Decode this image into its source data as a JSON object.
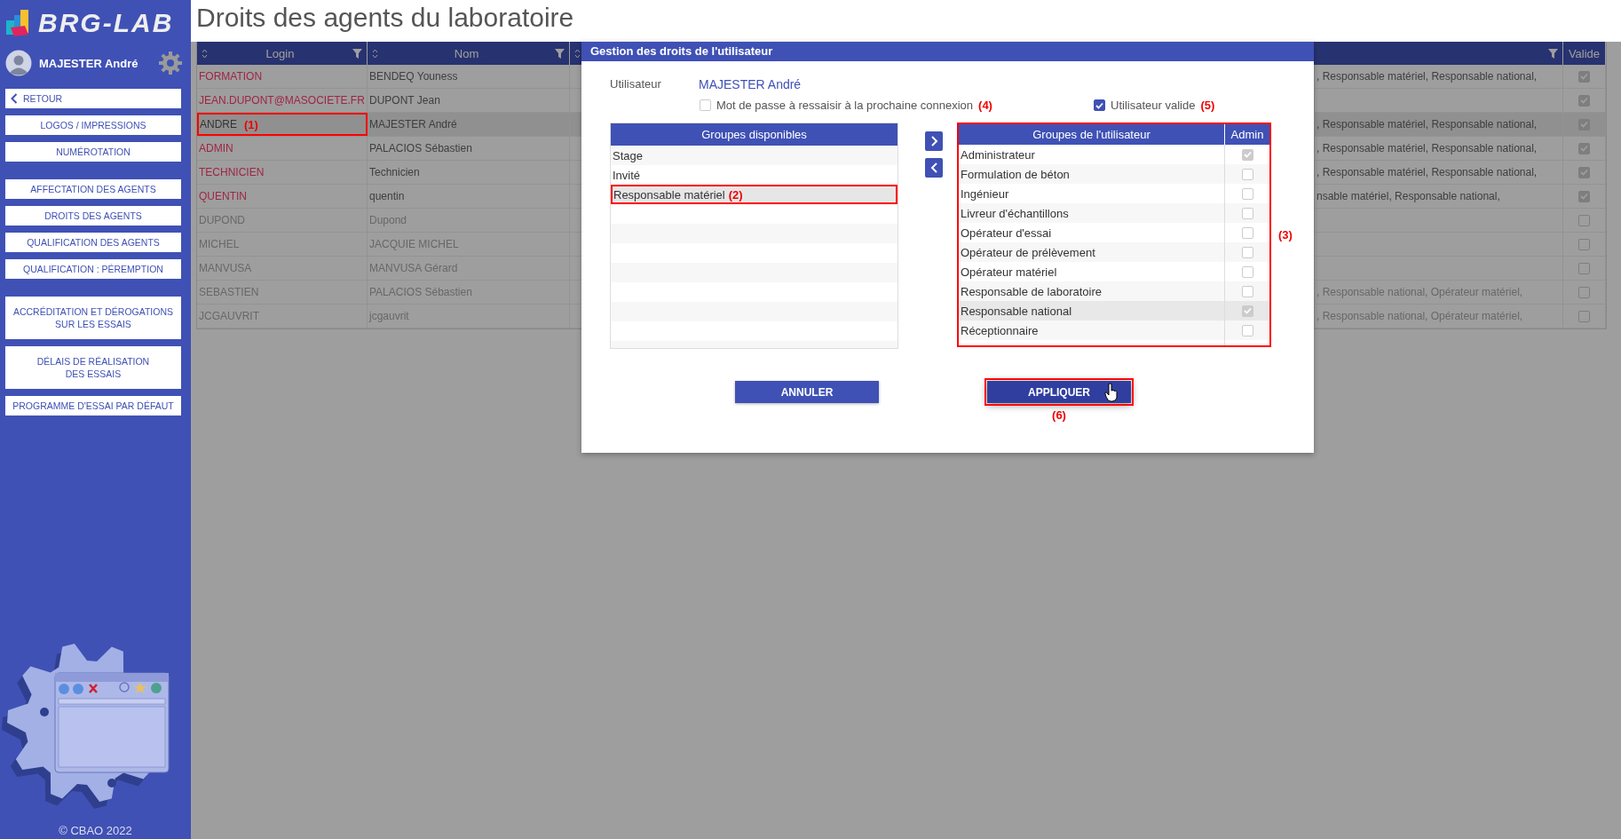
{
  "sidebar": {
    "logo": "BRG-LAB",
    "user": "MAJESTER André",
    "sections": [
      {
        "items": [
          {
            "label": "RETOUR",
            "kind": "back"
          },
          {
            "label": "LOGOS / IMPRESSIONS",
            "kind": "single"
          },
          {
            "label": "NUMÉROTATION",
            "kind": "single"
          }
        ]
      },
      {
        "items": [
          {
            "label": "AFFECTATION DES AGENTS",
            "kind": "single"
          },
          {
            "label": "DROITS DES AGENTS",
            "kind": "single"
          },
          {
            "label": "QUALIFICATION DES AGENTS",
            "kind": "single"
          },
          {
            "label": "QUALIFICATION : PÉREMPTION",
            "kind": "single"
          }
        ]
      },
      {
        "items": [
          {
            "label": "ACCRÉDITATION ET DÉROGATIONS\nSUR LES ESSAIS",
            "kind": "double"
          },
          {
            "label": "DÉLAIS DE RÉALISATION\nDES ESSAIS",
            "kind": "double"
          },
          {
            "label": "PROGRAMME D'ESSAI PAR DÉFAUT",
            "kind": "single"
          }
        ]
      }
    ],
    "copyright": "© CBAO 2022"
  },
  "page_title": "Droits des agents du laboratoire",
  "table": {
    "columns": [
      {
        "label": "Login",
        "sortable": true,
        "filter": true
      },
      {
        "label": "Nom",
        "sortable": true,
        "filter": true
      },
      {
        "sortable": true,
        "filter": true
      },
      {
        "label": "Valide",
        "sortable": false,
        "filter": false
      }
    ],
    "rows": [
      {
        "login": "FORMATION",
        "name": "BENDEQ Youness",
        "groups": ", Responsable matériel, Responsable national,",
        "valid": true,
        "selected": false
      },
      {
        "login": "JEAN.DUPONT@MASOCIETE.FR",
        "name": "DUPONT Jean",
        "valid": true,
        "selected": false
      },
      {
        "login": "ANDRE",
        "annotation": "(1)",
        "name": "MAJESTER André",
        "groups": ", Responsable matériel, Responsable national,",
        "valid": true,
        "selected": true
      },
      {
        "login": "ADMIN",
        "name": "PALACIOS Sébastien",
        "groups": ", Responsable matériel, Responsable national,",
        "valid": true,
        "selected": false
      },
      {
        "login": "TECHNICIEN",
        "name": "Technicien",
        "groups": ", Responsable matériel, Responsable national,",
        "valid": true,
        "selected": false
      },
      {
        "login": "QUENTIN",
        "name": "quentin",
        "groups": "nsable matériel, Responsable national,",
        "valid": true,
        "selected": false
      },
      {
        "login": "DUPOND",
        "name": "Dupond",
        "valid": false,
        "selected": false
      },
      {
        "login": "MICHEL",
        "name": "JACQUIE MICHEL",
        "valid": false,
        "selected": false
      },
      {
        "login": "MANVUSA",
        "name": "MANVUSA Gérard",
        "valid": false,
        "selected": false
      },
      {
        "login": "SEBASTIEN",
        "name": "PALACIOS Sébastien",
        "groups": ", Responsable national, Opérateur matériel,",
        "valid": false,
        "selected": false
      },
      {
        "login": "JCGAUVRIT",
        "name": "jcgauvrit",
        "groups": ", Responsable national, Opérateur matériel,",
        "valid": false,
        "selected": false
      }
    ]
  },
  "dialog": {
    "title": "Gestion des droits de l'utilisateur",
    "user_label": "Utilisateur",
    "user_value": "MAJESTER André",
    "options": [
      {
        "label": "Mot de passe à ressaisir à la prochaine connexion",
        "checked": false,
        "annotation": "(4)"
      },
      {
        "label": "Utilisateur valide",
        "checked": true,
        "annotation": "(5)"
      }
    ],
    "available": {
      "title": "Groupes disponibles",
      "items": [
        {
          "label": "Stage",
          "selected": false
        },
        {
          "label": "Invité",
          "selected": false
        },
        {
          "label": "Responsable matériel",
          "selected": true,
          "annotation": "(2)"
        }
      ]
    },
    "move_buttons": [
      {
        "kind": "right"
      },
      {
        "kind": "left"
      }
    ],
    "user_groups": {
      "title": "Groupes de l'utilisateur",
      "admin_label": "Admin",
      "annotation": "(3)",
      "items": [
        {
          "label": "Administrateur",
          "admin": true,
          "selected": false
        },
        {
          "label": "Formulation de béton",
          "admin": false,
          "selected": false
        },
        {
          "label": "Ingénieur",
          "admin": false,
          "selected": false
        },
        {
          "label": "Livreur d'échantillons",
          "admin": false,
          "selected": false
        },
        {
          "label": "Opérateur d'essai",
          "admin": false,
          "selected": false
        },
        {
          "label": "Opérateur de prélèvement",
          "admin": false,
          "selected": false
        },
        {
          "label": "Opérateur matériel",
          "admin": false,
          "selected": false
        },
        {
          "label": "Responsable de laboratoire",
          "admin": false,
          "selected": false
        },
        {
          "label": "Responsable national",
          "admin": true,
          "selected": true
        },
        {
          "label": "Réceptionnaire",
          "admin": false,
          "selected": false
        }
      ]
    },
    "buttons": [
      {
        "label": "ANNULER",
        "focused": false
      },
      {
        "label": "APPLIQUER",
        "focused": true,
        "annotation": "(6)"
      }
    ]
  }
}
